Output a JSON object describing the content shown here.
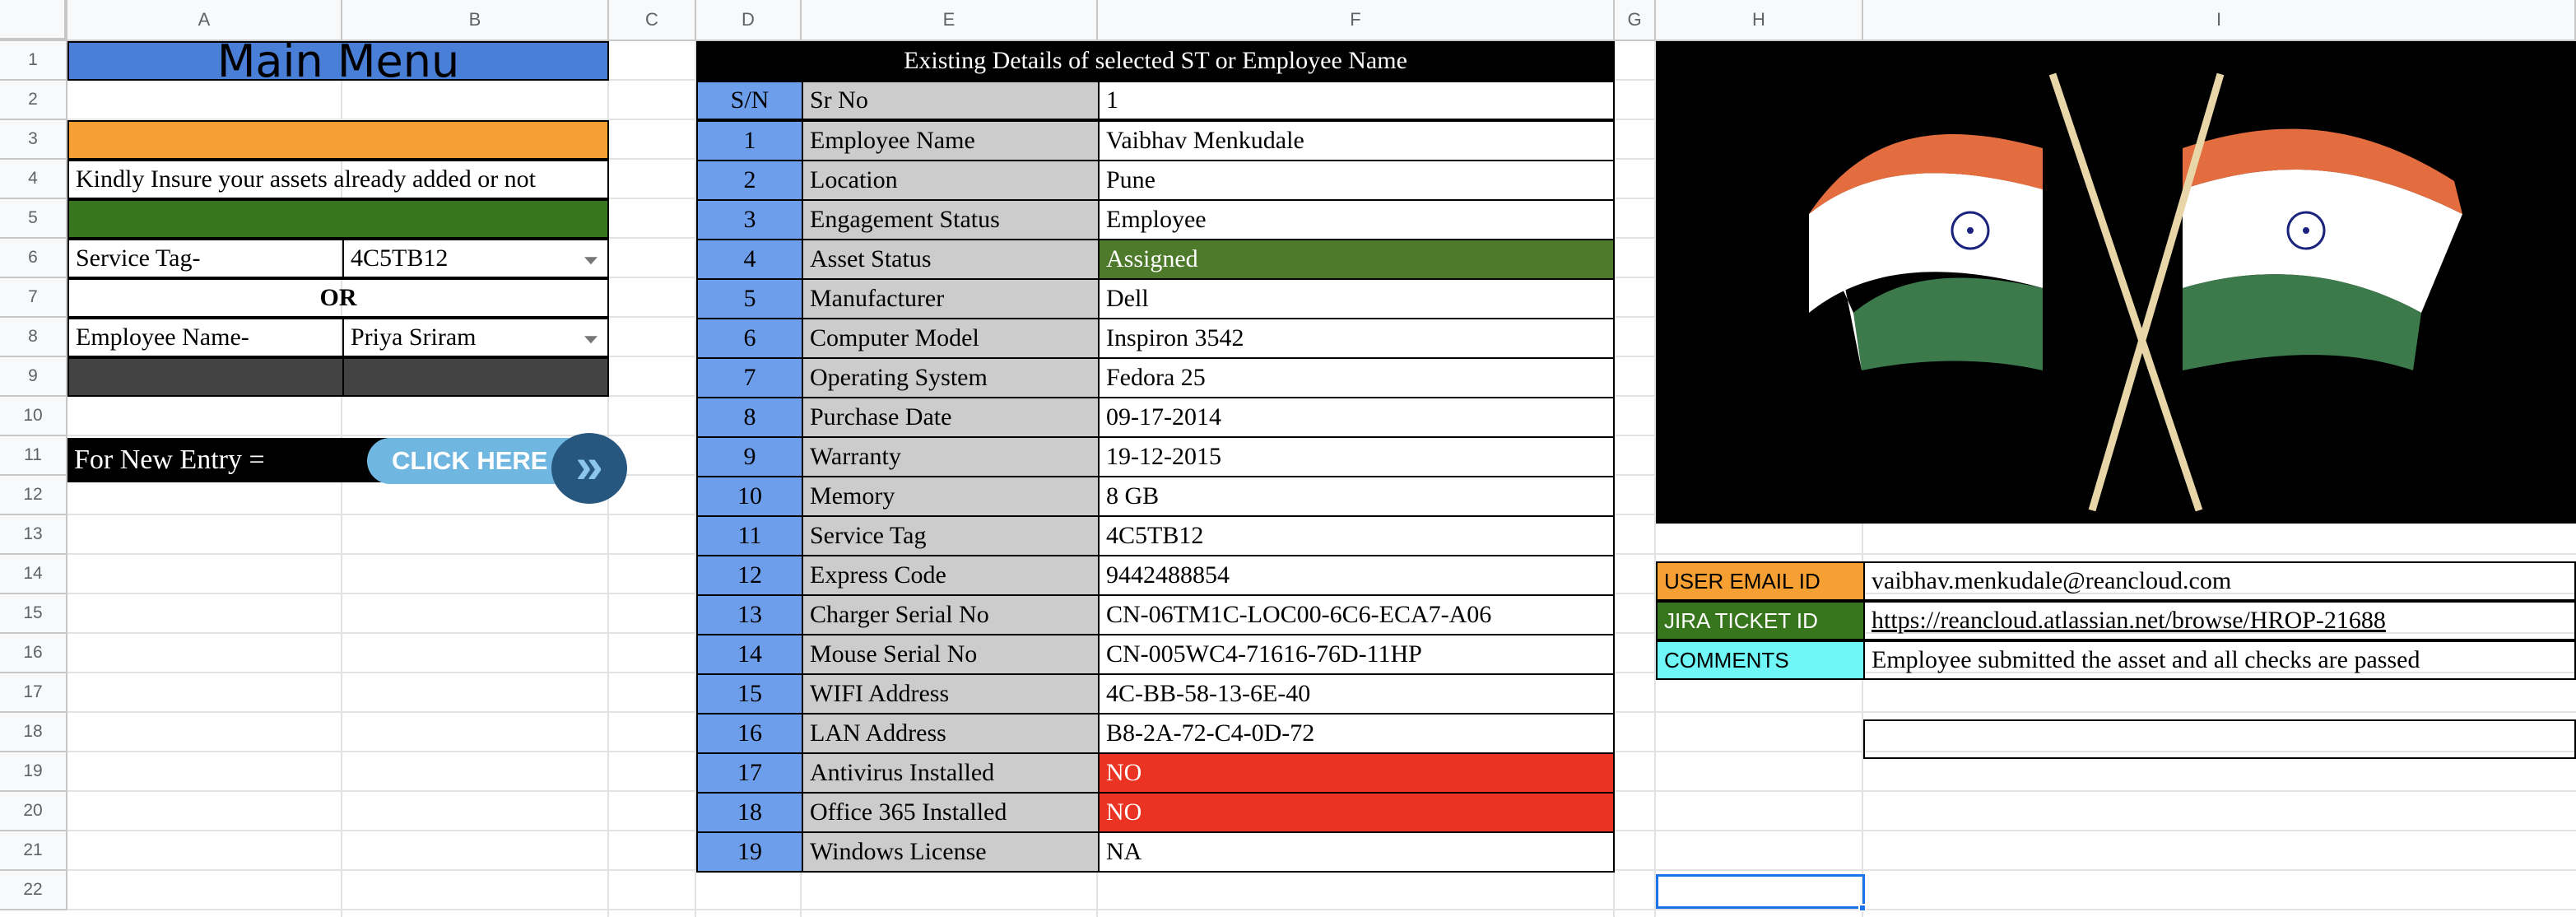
{
  "columns": [
    "A",
    "B",
    "C",
    "D",
    "E",
    "F",
    "G",
    "H",
    "I"
  ],
  "rows": [
    "1",
    "2",
    "3",
    "4",
    "5",
    "6",
    "7",
    "8",
    "9",
    "10",
    "11",
    "12",
    "13",
    "14",
    "15",
    "16",
    "17",
    "18",
    "19",
    "20",
    "21",
    "22"
  ],
  "menu": {
    "title": "Main Menu",
    "insure_text": "Kindly Insure your assets already added or not",
    "service_tag_label": "Service Tag-",
    "service_tag_value": "4C5TB12",
    "or_label": "OR",
    "employee_label": "Employee Name-",
    "employee_value": "Priya Sriram",
    "new_entry_label": "For New Entry =",
    "click_here": "CLICK HERE",
    "click_glyph": "»"
  },
  "details": {
    "header": "Existing Details of selected ST or Employee Name",
    "col_sn": "S/N",
    "first_label": "Sr No",
    "first_value": "1",
    "rows": [
      {
        "sn": "1",
        "label": "Employee Name",
        "value": "Vaibhav Menkudale"
      },
      {
        "sn": "2",
        "label": "Location",
        "value": "Pune"
      },
      {
        "sn": "3",
        "label": "Engagement Status",
        "value": "Employee"
      },
      {
        "sn": "4",
        "label": "Asset Status",
        "value": "Assigned"
      },
      {
        "sn": "5",
        "label": "Manufacturer",
        "value": "Dell"
      },
      {
        "sn": "6",
        "label": "Computer Model",
        "value": "Inspiron 3542"
      },
      {
        "sn": "7",
        "label": "Operating System",
        "value": "Fedora 25"
      },
      {
        "sn": "8",
        "label": "Purchase Date",
        "value": "09-17-2014"
      },
      {
        "sn": "9",
        "label": "Warranty",
        "value": "19-12-2015"
      },
      {
        "sn": "10",
        "label": "Memory",
        "value": "8 GB"
      },
      {
        "sn": "11",
        "label": "Service Tag",
        "value": "4C5TB12"
      },
      {
        "sn": "12",
        "label": "Express Code",
        "value": "9442488854"
      },
      {
        "sn": "13",
        "label": "Charger Serial No",
        "value": "CN-06TM1C-LOC00-6C6-ECA7-A06"
      },
      {
        "sn": "14",
        "label": "Mouse Serial No",
        "value": "CN-005WC4-71616-76D-11HP"
      },
      {
        "sn": "15",
        "label": "WIFI Address",
        "value": "4C-BB-58-13-6E-40"
      },
      {
        "sn": "16",
        "label": "LAN Address",
        "value": "B8-2A-72-C4-0D-72"
      },
      {
        "sn": "17",
        "label": "Antivirus Installed",
        "value": "NO"
      },
      {
        "sn": "18",
        "label": "Office 365 Installed",
        "value": "NO"
      },
      {
        "sn": "19",
        "label": "Windows License",
        "value": "NA"
      }
    ]
  },
  "info": {
    "email_label": "USER EMAIL ID",
    "email_value": "vaibhav.menkudale@reancloud.com",
    "jira_label": "JIRA TICKET ID",
    "jira_value": "https://reancloud.atlassian.net/browse/HROP-21688",
    "comments_label": "COMMENTS",
    "comments_value": "Employee submitted the asset and all checks are passed"
  },
  "colors": {
    "title_bar": "#4a7fd8",
    "orange": "#f6a033",
    "green": "#38761d",
    "dark": "#434343",
    "sn_blue": "#6d9eeb",
    "label_grey": "#cccccc",
    "assigned_green": "#4e7a2b",
    "no_red": "#ea3323",
    "comments_cyan": "#6ff6f6",
    "flag_saffron": "#e46d3f",
    "flag_green": "#3c7a4c",
    "selection_blue": "#1a73e8"
  },
  "icons": [
    "dropdown-arrow-icon",
    "double-chevron-right-icon",
    "india-flag-icon"
  ]
}
